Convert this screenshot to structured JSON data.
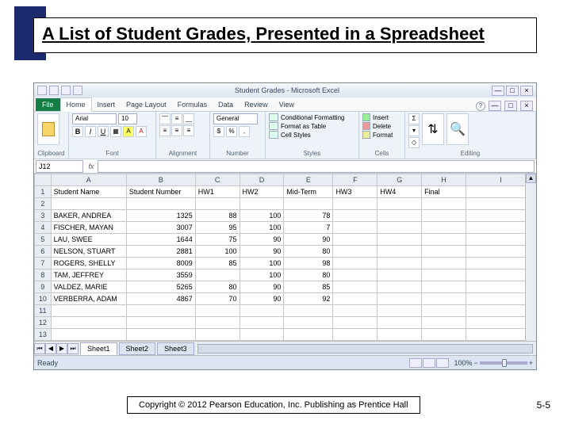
{
  "slide": {
    "title": "A List of Student Grades, Presented in a Spreadsheet",
    "copyright": "Copyright © 2012 Pearson Education, Inc. Publishing as Prentice Hall",
    "page": "5-5"
  },
  "excel": {
    "window_title": "Student Grades - Microsoft Excel",
    "file_tab": "File",
    "tabs": [
      "Home",
      "Insert",
      "Page Layout",
      "Formulas",
      "Data",
      "Review",
      "View"
    ],
    "win_min": "—",
    "win_max": "□",
    "win_close": "×",
    "help_q": "?",
    "ribbon": {
      "paste": "Paste",
      "clipboard": "Clipboard",
      "font_name": "Arial",
      "font_size": "10",
      "font": "Font",
      "alignment": "Alignment",
      "general": "General",
      "number": "Number",
      "cond_fmt": "Conditional Formatting",
      "fmt_table": "Format as Table",
      "cell_styles": "Cell Styles",
      "styles": "Styles",
      "insert": "Insert",
      "delete": "Delete",
      "format": "Format",
      "cells": "Cells",
      "sort": "Sort & Filter",
      "find": "Find & Select",
      "editing": "Editing"
    },
    "namebox": "J12",
    "fx": "fx",
    "col_letters": [
      "A",
      "B",
      "C",
      "D",
      "E",
      "F",
      "G",
      "H",
      "I"
    ],
    "headers": [
      "Student Name",
      "Student Number",
      "HW1",
      "HW2",
      "Mid-Term",
      "HW3",
      "HW4",
      "Final"
    ],
    "rows": [
      {
        "n": "2",
        "name": "",
        "num": "",
        "c": [
          "",
          "",
          "",
          "",
          "",
          ""
        ]
      },
      {
        "n": "3",
        "name": "BAKER, ANDREA",
        "num": "1325",
        "c": [
          "88",
          "100",
          "78",
          "",
          "",
          ""
        ]
      },
      {
        "n": "4",
        "name": "FISCHER, MAYAN",
        "num": "3007",
        "c": [
          "95",
          "100",
          "7",
          "",
          "",
          ""
        ]
      },
      {
        "n": "5",
        "name": "LAU, SWEE",
        "num": "1644",
        "c": [
          "75",
          "90",
          "90",
          "",
          "",
          ""
        ]
      },
      {
        "n": "6",
        "name": "NELSON, STUART",
        "num": "2881",
        "c": [
          "100",
          "90",
          "80",
          "",
          "",
          ""
        ]
      },
      {
        "n": "7",
        "name": "ROGERS, SHELLY",
        "num": "8009",
        "c": [
          "85",
          "100",
          "98",
          "",
          "",
          ""
        ]
      },
      {
        "n": "8",
        "name": "TAM, JEFFREY",
        "num": "3559",
        "c": [
          "",
          "100",
          "80",
          "",
          "",
          ""
        ]
      },
      {
        "n": "9",
        "name": "VALDEZ, MARIE",
        "num": "5265",
        "c": [
          "80",
          "90",
          "85",
          "",
          "",
          ""
        ]
      },
      {
        "n": "10",
        "name": "VERBERRA, ADAM",
        "num": "4867",
        "c": [
          "70",
          "90",
          "92",
          "",
          "",
          ""
        ]
      },
      {
        "n": "11",
        "name": "",
        "num": "",
        "c": [
          "",
          "",
          "",
          "",
          "",
          ""
        ]
      },
      {
        "n": "12",
        "name": "",
        "num": "",
        "c": [
          "",
          "",
          "",
          "",
          "",
          ""
        ]
      },
      {
        "n": "13",
        "name": "",
        "num": "",
        "c": [
          "",
          "",
          "",
          "",
          "",
          ""
        ]
      }
    ],
    "sheets": [
      "Sheet1",
      "Sheet2",
      "Sheet3"
    ],
    "status_ready": "Ready",
    "zoom_pct": "100%"
  }
}
